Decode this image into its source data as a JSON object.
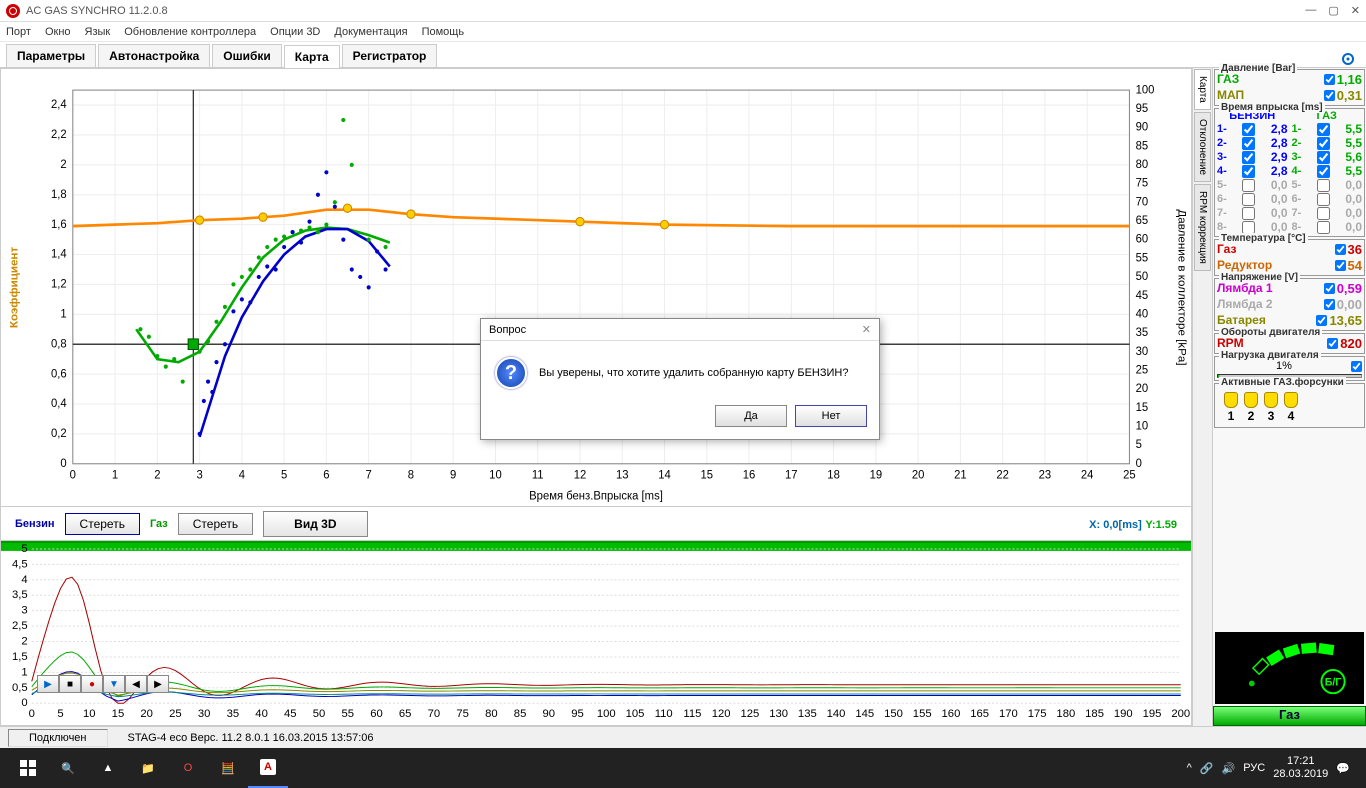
{
  "app": {
    "title": "AC GAS SYNCHRO  11.2.0.8"
  },
  "menu": [
    "Порт",
    "Окно",
    "Язык",
    "Обновление контроллера",
    "Опции 3D",
    "Документация",
    "Помощь"
  ],
  "tabs": [
    {
      "label": "Параметры"
    },
    {
      "label": "Автонастройка"
    },
    {
      "label": "Ошибки"
    },
    {
      "label": "Карта",
      "active": true
    },
    {
      "label": "Регистратор"
    }
  ],
  "right_tabs": [
    {
      "label": "Карта",
      "active": true
    },
    {
      "label": "Отклонение"
    },
    {
      "label": "RPM коррекция"
    }
  ],
  "chart_controls": {
    "benzin_label": "Бензин",
    "gas_label": "Газ",
    "erase_label": "Стереть",
    "view3d_label": "Вид 3D",
    "coord_x_label": "X:",
    "coord_x_val": "0,0[ms]",
    "coord_y_label": "Y:",
    "coord_y_val": "1.59"
  },
  "chart_data": {
    "type": "scatter",
    "xlabel": "Время бенз.Впрыска [ms]",
    "ylabel": "Коэффициент",
    "y2label": "Давление в коллекторе [kPa]",
    "x_ticks": [
      0,
      1,
      2,
      3,
      4,
      5,
      6,
      7,
      8,
      9,
      10,
      11,
      12,
      13,
      14,
      15,
      16,
      17,
      18,
      19,
      20,
      21,
      22,
      23,
      24,
      25
    ],
    "y_ticks": [
      0,
      0.2,
      0.4,
      0.6,
      0.8,
      1,
      1.2,
      1.4,
      1.6,
      1.8,
      2,
      2.2,
      2.4
    ],
    "y2_ticks": [
      0,
      5,
      10,
      15,
      20,
      25,
      30,
      35,
      40,
      45,
      50,
      55,
      60,
      65,
      70,
      75,
      80,
      85,
      90,
      95,
      100
    ],
    "series": [
      {
        "name": "orange_line",
        "color": "#f80",
        "type": "line",
        "data": [
          [
            0,
            1.59
          ],
          [
            1,
            1.6
          ],
          [
            2,
            1.61
          ],
          [
            3,
            1.63
          ],
          [
            4,
            1.64
          ],
          [
            5,
            1.66
          ],
          [
            6,
            1.7
          ],
          [
            7,
            1.7
          ],
          [
            8,
            1.67
          ],
          [
            9,
            1.65
          ],
          [
            12,
            1.62
          ],
          [
            14,
            1.6
          ],
          [
            17,
            1.59
          ],
          [
            25,
            1.59
          ]
        ]
      },
      {
        "name": "orange_nodes",
        "color": "#fc0",
        "type": "scatter",
        "data": [
          [
            3,
            1.63
          ],
          [
            4.5,
            1.65
          ],
          [
            6.5,
            1.71
          ],
          [
            8,
            1.67
          ],
          [
            12,
            1.62
          ],
          [
            14,
            1.6
          ]
        ]
      },
      {
        "name": "green_curve",
        "color": "#0a0",
        "type": "line",
        "data": [
          [
            1.5,
            0.9
          ],
          [
            2,
            0.7
          ],
          [
            2.5,
            0.68
          ],
          [
            3,
            0.75
          ],
          [
            3.5,
            0.95
          ],
          [
            4,
            1.18
          ],
          [
            4.5,
            1.38
          ],
          [
            5,
            1.5
          ],
          [
            5.5,
            1.56
          ],
          [
            6,
            1.58
          ],
          [
            6.5,
            1.57
          ],
          [
            7,
            1.53
          ],
          [
            7.5,
            1.48
          ]
        ]
      },
      {
        "name": "blue_curve",
        "color": "#00c",
        "type": "line",
        "data": [
          [
            3,
            0.18
          ],
          [
            3.3,
            0.45
          ],
          [
            3.6,
            0.72
          ],
          [
            4,
            0.98
          ],
          [
            4.5,
            1.22
          ],
          [
            5,
            1.4
          ],
          [
            5.5,
            1.52
          ],
          [
            6,
            1.57
          ],
          [
            6.5,
            1.57
          ],
          [
            7,
            1.49
          ],
          [
            7.5,
            1.32
          ]
        ]
      },
      {
        "name": "green_pts",
        "color": "#0a0",
        "type": "scatter",
        "data": [
          [
            1.6,
            0.9
          ],
          [
            1.8,
            0.85
          ],
          [
            2.0,
            0.72
          ],
          [
            2.2,
            0.65
          ],
          [
            2.4,
            0.7
          ],
          [
            2.6,
            0.55
          ],
          [
            2.8,
            0.78
          ],
          [
            3.0,
            0.75
          ],
          [
            3.2,
            0.82
          ],
          [
            3.4,
            0.95
          ],
          [
            3.6,
            1.05
          ],
          [
            3.8,
            1.2
          ],
          [
            4.0,
            1.25
          ],
          [
            4.2,
            1.3
          ],
          [
            4.4,
            1.38
          ],
          [
            4.6,
            1.45
          ],
          [
            4.8,
            1.5
          ],
          [
            5.0,
            1.52
          ],
          [
            5.2,
            1.55
          ],
          [
            5.4,
            1.56
          ],
          [
            5.6,
            1.58
          ],
          [
            5.8,
            1.55
          ],
          [
            6.0,
            1.6
          ],
          [
            6.2,
            1.75
          ],
          [
            6.4,
            2.3
          ],
          [
            6.6,
            2.0
          ],
          [
            7.0,
            1.5
          ],
          [
            7.4,
            1.45
          ]
        ]
      },
      {
        "name": "blue_pts",
        "color": "#00c",
        "type": "scatter",
        "data": [
          [
            3.0,
            0.2
          ],
          [
            3.1,
            0.42
          ],
          [
            3.2,
            0.55
          ],
          [
            3.3,
            0.48
          ],
          [
            3.4,
            0.68
          ],
          [
            3.6,
            0.8
          ],
          [
            3.8,
            1.02
          ],
          [
            4.0,
            1.1
          ],
          [
            4.2,
            1.08
          ],
          [
            4.4,
            1.25
          ],
          [
            4.6,
            1.32
          ],
          [
            4.8,
            1.3
          ],
          [
            5.0,
            1.45
          ],
          [
            5.2,
            1.55
          ],
          [
            5.4,
            1.48
          ],
          [
            5.6,
            1.62
          ],
          [
            5.8,
            1.8
          ],
          [
            6.0,
            1.95
          ],
          [
            6.2,
            1.72
          ],
          [
            6.4,
            1.5
          ],
          [
            6.6,
            1.3
          ],
          [
            6.8,
            1.25
          ],
          [
            7.0,
            1.18
          ],
          [
            7.2,
            1.42
          ],
          [
            7.4,
            1.3
          ]
        ]
      }
    ],
    "marker": {
      "x": 2.85,
      "y": 0.8
    }
  },
  "meters": {
    "pressure": {
      "title": "Давление [Bar]",
      "rows": [
        {
          "label": "ГАЗ",
          "val": "1,16",
          "c": "c-green"
        },
        {
          "label": "МАП",
          "val": "0,31",
          "c": "c-olive"
        }
      ]
    },
    "inj_time": {
      "title": "Время впрыска [ms]",
      "benz_label": "БЕНЗИН",
      "gas_label": "ГАЗ",
      "benz": [
        {
          "n": "1",
          "v": "2,8",
          "c": "c-blue"
        },
        {
          "n": "2",
          "v": "2,8",
          "c": "c-blue"
        },
        {
          "n": "3",
          "v": "2,9",
          "c": "c-blue"
        },
        {
          "n": "4",
          "v": "2,8",
          "c": "c-blue"
        },
        {
          "n": "5",
          "v": "0,0",
          "c": "c-gray"
        },
        {
          "n": "6",
          "v": "0,0",
          "c": "c-gray"
        },
        {
          "n": "7",
          "v": "0,0",
          "c": "c-gray"
        },
        {
          "n": "8",
          "v": "0,0",
          "c": "c-gray"
        }
      ],
      "gas": [
        {
          "n": "1",
          "v": "5,5",
          "c": "c-green"
        },
        {
          "n": "2",
          "v": "5,5",
          "c": "c-green"
        },
        {
          "n": "3",
          "v": "5,6",
          "c": "c-green"
        },
        {
          "n": "4",
          "v": "5,5",
          "c": "c-green"
        },
        {
          "n": "5",
          "v": "0,0",
          "c": "c-gray"
        },
        {
          "n": "6",
          "v": "0,0",
          "c": "c-gray"
        },
        {
          "n": "7",
          "v": "0,0",
          "c": "c-gray"
        },
        {
          "n": "8",
          "v": "0,0",
          "c": "c-gray"
        }
      ]
    },
    "temp": {
      "title": "Температура [°C]",
      "rows": [
        {
          "label": "Газ",
          "val": "36",
          "c": "c-red"
        },
        {
          "label": "Редуктор",
          "val": "54",
          "c": "c-orange"
        }
      ]
    },
    "volt": {
      "title": "Напряжение [V]",
      "rows": [
        {
          "label": "Лямбда 1",
          "val": "0,59",
          "c": "c-mag"
        },
        {
          "label": "Лямбда 2",
          "val": "0,00",
          "c": "c-gray"
        },
        {
          "label": "Батарея",
          "val": "13,65",
          "c": "c-olive"
        }
      ]
    },
    "rpm": {
      "title": "Обороты двигателя",
      "rows": [
        {
          "label": "RPM",
          "val": "820",
          "c": "c-red"
        }
      ]
    },
    "load": {
      "title": "Нагрузка двигателя",
      "val": "1%"
    },
    "injectors": {
      "title": "Активные ГАЗ.форсунки",
      "items": [
        "1",
        "2",
        "3",
        "4"
      ]
    }
  },
  "dialog": {
    "title": "Вопрос",
    "message": "Вы уверены, что хотите удалить собранную карту БЕНЗИН?",
    "yes": "Да",
    "no": "Нет"
  },
  "status": {
    "conn": "Подключен",
    "ver": "STAG-4 eco    Верс. 11.2  8.0.1    16.03.2015 13:57:06",
    "gas_btn": "Газ"
  },
  "taskbar": {
    "lang": "РУС",
    "time": "17:21",
    "date": "28.03.2019"
  },
  "timeline": {
    "y_ticks": [
      "5",
      "4,5",
      "4",
      "3,5",
      "3",
      "2,5",
      "2",
      "1,5",
      "1",
      "0,5",
      "0"
    ],
    "x_ticks": [
      0,
      5,
      10,
      15,
      20,
      25,
      30,
      35,
      40,
      45,
      50,
      55,
      60,
      65,
      70,
      75,
      80,
      85,
      90,
      95,
      100,
      105,
      110,
      115,
      120,
      125,
      130,
      135,
      140,
      145,
      150,
      155,
      160,
      165,
      170,
      175,
      180,
      185,
      190,
      195,
      200
    ]
  }
}
